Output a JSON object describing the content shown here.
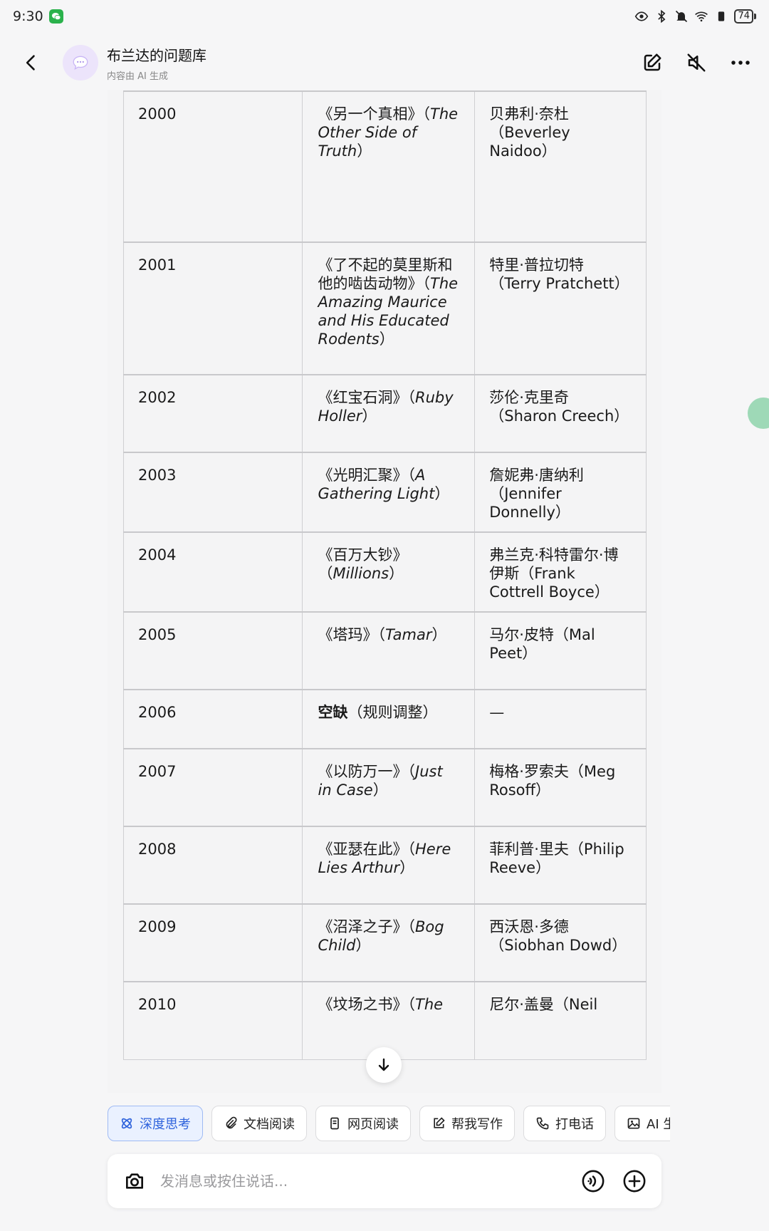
{
  "status_bar": {
    "time": "9:30",
    "battery": "74"
  },
  "header": {
    "title": "布兰达的问题库",
    "subtitle": "内容由 AI 生成"
  },
  "table": {
    "rows": [
      {
        "year": "2000",
        "book_cn": "《另一个真相》（",
        "book_en": "The Other Side of Truth",
        "book_tail": "）",
        "author": "贝弗利·奈杜（Beverley Naidoo）",
        "height": 212
      },
      {
        "year": "2001",
        "book_cn": "《了不起的莫里斯和他的啮齿动物》（",
        "book_en": "The Amazing Maurice and His Educated Rodents",
        "book_tail": "）",
        "author": "特里·普拉切特（Terry Pratchett）",
        "height": 186
      },
      {
        "year": "2002",
        "book_cn": "《红宝石洞》（",
        "book_en": "Ruby Holler",
        "book_tail": "）",
        "author": "莎伦·克里奇（Sharon Creech）",
        "height": 109
      },
      {
        "year": "2003",
        "book_cn": "《光明汇聚》（",
        "book_en": "A Gathering Light",
        "book_tail": "）",
        "author": "詹妮弗·唐纳利（Jennifer Donnelly）",
        "height": 109
      },
      {
        "year": "2004",
        "book_cn": "《百万大钞》（",
        "book_en": "Millions",
        "book_tail": "）",
        "author": "弗兰克·科特雷尔·博伊斯（Frank Cottrell Boyce）",
        "height": 109
      },
      {
        "year": "2005",
        "book_cn": "《塔玛》（",
        "book_en": "Tamar",
        "book_tail": "）",
        "author": "马尔·皮特（Mal Peet）",
        "height": 109
      },
      {
        "year": "2006",
        "book_bold": "空缺",
        "book_cn": "（规则调整）",
        "book_en": "",
        "book_tail": "",
        "author": "—",
        "height": 83
      },
      {
        "year": "2007",
        "book_cn": "《以防万一》（",
        "book_en": "Just in Case",
        "book_tail": "）",
        "author": "梅格·罗索夫（Meg Rosoff）",
        "height": 109
      },
      {
        "year": "2008",
        "book_cn": "《亚瑟在此》（",
        "book_en": "Here Lies Arthur",
        "book_tail": "）",
        "author": "菲利普·里夫（Philip Reeve）",
        "height": 109
      },
      {
        "year": "2009",
        "book_cn": "《沼泽之子》（",
        "book_en": "Bog Child",
        "book_tail": "）",
        "author": "西沃恩·多德（Siobhan Dowd）",
        "height": 109
      },
      {
        "year": "2010",
        "book_cn": "《坟场之书》（",
        "book_en": "The",
        "book_tail": "",
        "author": "尼尔·盖曼（Neil",
        "height": 109
      }
    ]
  },
  "chips": [
    {
      "label": "深度思考",
      "icon": "atom-icon",
      "active": true
    },
    {
      "label": "文档阅读",
      "icon": "paperclip-icon"
    },
    {
      "label": "网页阅读",
      "icon": "page-icon"
    },
    {
      "label": "帮我写作",
      "icon": "write-icon"
    },
    {
      "label": "打电话",
      "icon": "phone-icon"
    },
    {
      "label": "AI 生",
      "icon": "image-icon"
    }
  ],
  "input": {
    "placeholder": "发消息或按住说话..."
  }
}
